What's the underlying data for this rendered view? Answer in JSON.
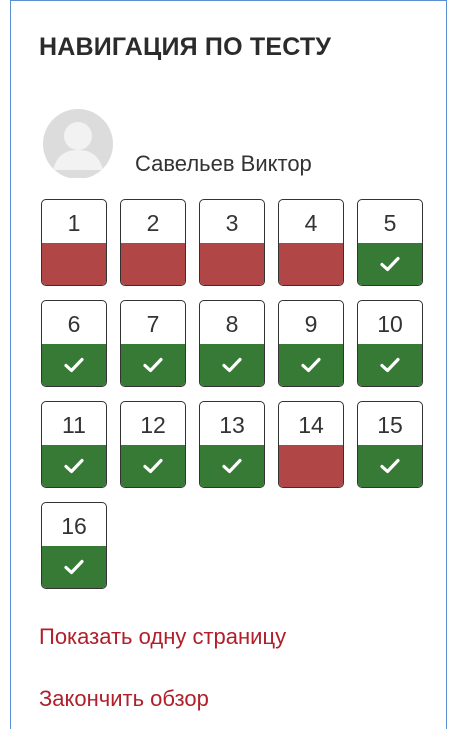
{
  "block": {
    "title": "НАВИГАЦИЯ ПО ТЕСТУ",
    "user": {
      "name": "Савельев Виктор",
      "avatar_icon": "default-user-avatar-icon"
    },
    "questions": [
      {
        "number": "1",
        "status": "incorrect"
      },
      {
        "number": "2",
        "status": "incorrect"
      },
      {
        "number": "3",
        "status": "incorrect"
      },
      {
        "number": "4",
        "status": "incorrect"
      },
      {
        "number": "5",
        "status": "correct"
      },
      {
        "number": "6",
        "status": "correct"
      },
      {
        "number": "7",
        "status": "correct"
      },
      {
        "number": "8",
        "status": "correct"
      },
      {
        "number": "9",
        "status": "correct"
      },
      {
        "number": "10",
        "status": "correct"
      },
      {
        "number": "11",
        "status": "correct"
      },
      {
        "number": "12",
        "status": "correct"
      },
      {
        "number": "13",
        "status": "correct"
      },
      {
        "number": "14",
        "status": "incorrect"
      },
      {
        "number": "15",
        "status": "correct"
      },
      {
        "number": "16",
        "status": "correct"
      }
    ],
    "links": {
      "show_one_page": "Показать одну страницу",
      "finish_review": "Закончить обзор"
    }
  },
  "colors": {
    "correct": "#367a36",
    "incorrect": "#b04646",
    "link": "#b0202a",
    "panel_border": "#5b8fd4"
  }
}
